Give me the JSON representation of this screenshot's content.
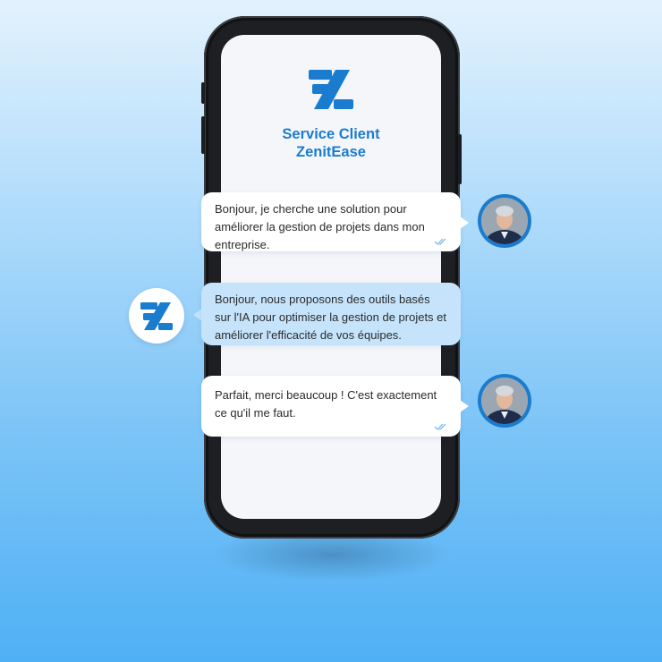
{
  "app": {
    "title_line1": "Service Client",
    "title_line2": "ZenitEase",
    "logo": "zenitease-logo"
  },
  "messages": [
    {
      "sender": "user",
      "text": "Bonjour, je cherche une solution pour améliorer la gestion de projets dans mon entreprise.",
      "read": true
    },
    {
      "sender": "agent",
      "text": "Bonjour, nous proposons des outils basés sur l'IA pour optimiser la gestion de projets et améliorer l'efficacité de vos équipes.",
      "read": false
    },
    {
      "sender": "user",
      "text": "Parfait, merci beaucoup ! C'est exactement ce qu'il me faut.",
      "read": true
    }
  ],
  "colors": {
    "accent": "#1a7ccf",
    "agent_bubble": "#c5e4fb",
    "user_bubble": "#ffffff",
    "background_top": "#e3f2fd",
    "background_bottom": "#4fb0f5"
  },
  "icons": {
    "read_receipt": "double-check-icon",
    "user_avatar": "user-avatar-photo",
    "agent_avatar": "zenitease-logo"
  }
}
